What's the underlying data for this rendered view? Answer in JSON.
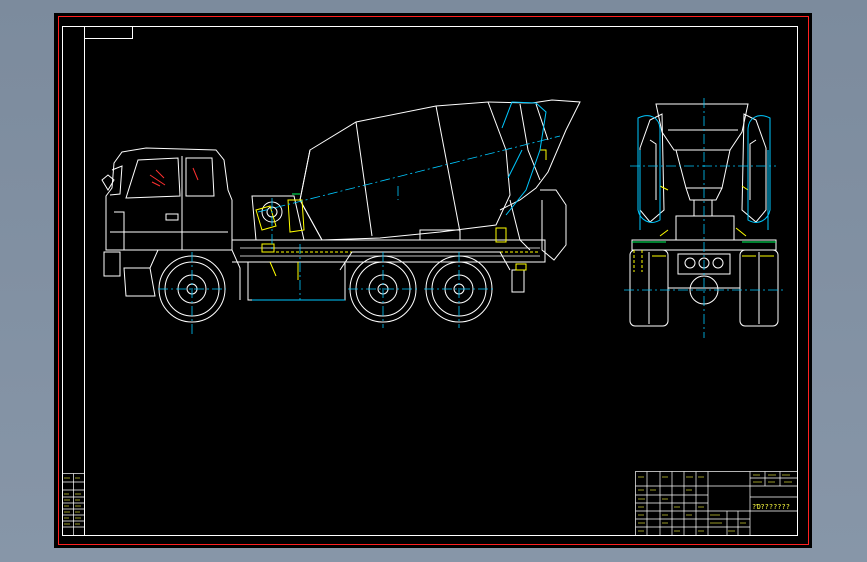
{
  "drawing": {
    "title_block_text": "?Ɗ???????",
    "left_table_rows": [],
    "colors": {
      "app_background": "#7f8ea0",
      "sheet": "#000000",
      "outer_border": "#ff2020",
      "frame": "#ffffff",
      "body_lines": "#ffffff",
      "center_lines": "#00c8ff",
      "hatching_yellow": "#ffff00",
      "hatching_green": "#00ff60"
    },
    "views": [
      "side-view",
      "rear-view"
    ]
  }
}
